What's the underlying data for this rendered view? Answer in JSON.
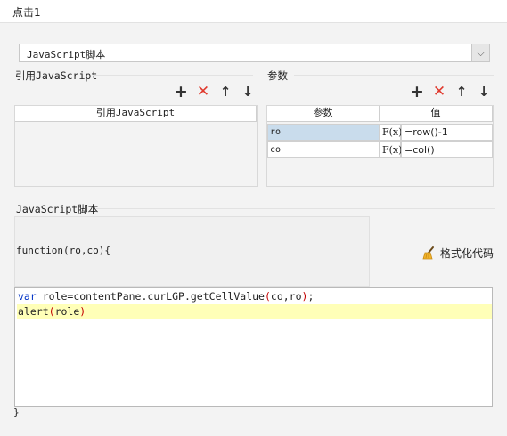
{
  "tab": {
    "title": "点击1"
  },
  "script_type": {
    "selected": "JavaScript脚本"
  },
  "reference_section": {
    "title": "引用JavaScript",
    "column_header": "引用JavaScript",
    "toolbar": {
      "add": "+",
      "delete": "✕",
      "up": "↑",
      "down": "↓"
    }
  },
  "params_section": {
    "title": "参数",
    "columns": [
      "参数",
      "值"
    ],
    "rows": [
      {
        "name": "ro",
        "fx": "F(x)",
        "value": "=row()-1"
      },
      {
        "name": "co",
        "fx": "F(x)",
        "value": "=col()"
      }
    ],
    "toolbar": {
      "add": "+",
      "delete": "✕",
      "up": "↑",
      "down": "↓"
    }
  },
  "js_section": {
    "title": "JavaScript脚本",
    "signature": "function(ro,co){",
    "format_button": "格式化代码",
    "format_icon": "broom-icon",
    "code": {
      "line1_kw": "var",
      "line1_rest": " role=contentPane.curLGP.getCellValue",
      "line1_open": "(",
      "line1_args": "co,ro",
      "line1_close": ")",
      "line1_end": ";",
      "line2_fn": "alert",
      "line2_open": "(",
      "line2_arg": "role",
      "line2_close": ")"
    },
    "closing_brace": "}"
  },
  "colors": {
    "keyword": "#0033c6",
    "paren": "#c40000",
    "delete_icon": "#e03a2e",
    "highlight": "#ffffb8",
    "selected_cell": "#c9dcec"
  }
}
